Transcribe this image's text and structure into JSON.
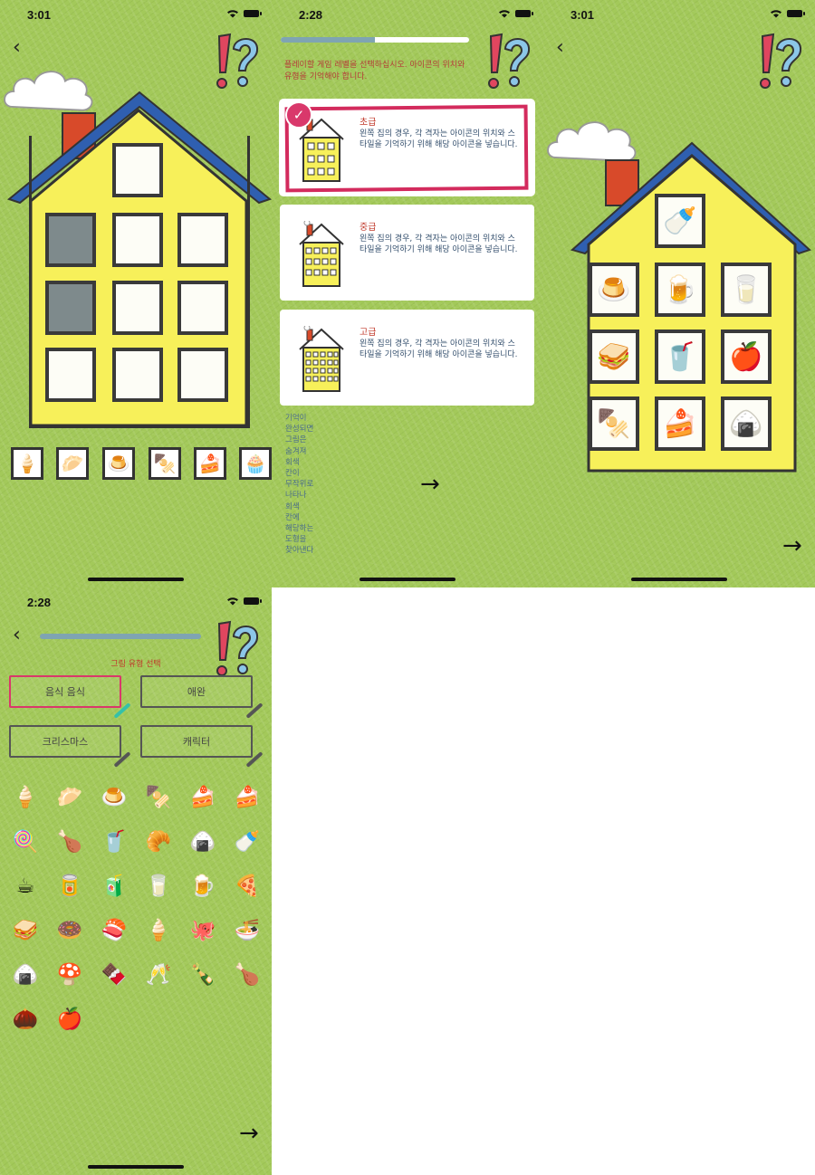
{
  "screens": {
    "s1": {
      "time": "3:01",
      "tray_items": [
        {
          "icon": "ice-cream-icon",
          "glyph": "🍦"
        },
        {
          "icon": "bun-icon",
          "glyph": "🥟"
        },
        {
          "icon": "pudding-icon",
          "glyph": "🍮"
        },
        {
          "icon": "skewer-icon",
          "glyph": "🍢"
        },
        {
          "icon": "cake-icon",
          "glyph": "🍰"
        },
        {
          "icon": "cake-slice-icon",
          "glyph": "🧁"
        }
      ]
    },
    "s2": {
      "time": "2:28",
      "progress": 0.5,
      "instruction": "플레이할 게임 레벨을 선택하십시오. 아이콘의 위치와 유형을 기억해야 합니다.",
      "levels": [
        {
          "title": "초급",
          "desc": "왼쪽 집의 경우, 각 격자는 아이콘의 위치와 스타일을 기억하기 위해 해당 아이콘을 넣습니다.",
          "selected": true
        },
        {
          "title": "중급",
          "desc": "왼쪽 집의 경우, 각 격자는 아이콘의 위치와 스타일을 기억하기 위해 해당 아이콘을 넣습니다.",
          "selected": false
        },
        {
          "title": "고급",
          "desc": "왼쪽 집의 경우, 각 격자는 아이콘의 위치와 스타일을 기억하기 위해 해당 아이콘을 넣습니다.",
          "selected": false
        }
      ],
      "vertical_text": [
        "기억이",
        "완성되면",
        "그림은",
        "숨겨져",
        "회색",
        "칸이",
        "무작위로",
        "나타나",
        "회색",
        "칸에",
        "해당하는",
        "도형을",
        "찾아낸다"
      ]
    },
    "s3": {
      "time": "3:01",
      "grid": [
        {
          "icon": "milk-bottle-icon",
          "glyph": "🍼"
        },
        {
          "icon": "pudding-icon",
          "glyph": "🍮"
        },
        {
          "icon": "beer-icon",
          "glyph": "🍺"
        },
        {
          "icon": "milk-carton-icon",
          "glyph": "🥛"
        },
        {
          "icon": "sandwich-icon",
          "glyph": "🥪"
        },
        {
          "icon": "iced-drink-icon",
          "glyph": "🥤"
        },
        {
          "icon": "apple-icon",
          "glyph": "🍎"
        },
        {
          "icon": "skewer-icon",
          "glyph": "🍢"
        },
        {
          "icon": "cake-icon",
          "glyph": "🍰"
        },
        {
          "icon": "rice-dumpling-icon",
          "glyph": "🍙"
        }
      ]
    },
    "s4": {
      "time": "2:28",
      "title": "그림 유형 선택",
      "categories": [
        "음식 음식",
        "애완",
        "크리스마스",
        "캐릭터"
      ],
      "foods": [
        {
          "icon": "ice-cream-cone-icon",
          "glyph": "🍦"
        },
        {
          "icon": "bun-icon",
          "glyph": "🥟"
        },
        {
          "icon": "pudding-icon",
          "glyph": "🍮"
        },
        {
          "icon": "skewer-icon",
          "glyph": "🍢"
        },
        {
          "icon": "cake-icon",
          "glyph": "🍰"
        },
        {
          "icon": "cake-slice-icon",
          "glyph": "🍰"
        },
        {
          "icon": "lollipop-icon",
          "glyph": "🍭"
        },
        {
          "icon": "drumstick-icon",
          "glyph": "🍗"
        },
        {
          "icon": "iced-drink-icon",
          "glyph": "🥤"
        },
        {
          "icon": "roll-cake-icon",
          "glyph": "🥐"
        },
        {
          "icon": "onigiri-icon",
          "glyph": "🍙"
        },
        {
          "icon": "milk-bottle-icon",
          "glyph": "🍼"
        },
        {
          "icon": "coffee-cup-icon",
          "glyph": "☕"
        },
        {
          "icon": "soda-can-icon",
          "glyph": "🥫"
        },
        {
          "icon": "juice-box-icon",
          "glyph": "🧃"
        },
        {
          "icon": "milk-carton-icon",
          "glyph": "🥛"
        },
        {
          "icon": "beer-icon",
          "glyph": "🍺"
        },
        {
          "icon": "pizza-icon",
          "glyph": "🍕"
        },
        {
          "icon": "sandwich-icon",
          "glyph": "🥪"
        },
        {
          "icon": "donut-icon",
          "glyph": "🍩"
        },
        {
          "icon": "sushi-icon",
          "glyph": "🍣"
        },
        {
          "icon": "soft-serve-icon",
          "glyph": "🍦"
        },
        {
          "icon": "octopus-icon",
          "glyph": "🐙"
        },
        {
          "icon": "noodle-bowl-icon",
          "glyph": "🍜"
        },
        {
          "icon": "rice-dumpling-icon",
          "glyph": "🍙"
        },
        {
          "icon": "mushroom-icon",
          "glyph": "🍄"
        },
        {
          "icon": "popsicle-icon",
          "glyph": "🍫"
        },
        {
          "icon": "wine-glasses-icon",
          "glyph": "🥂"
        },
        {
          "icon": "wine-bottle-icon",
          "glyph": "🍾"
        },
        {
          "icon": "roast-chicken-icon",
          "glyph": "🍗"
        },
        {
          "icon": "pinecone-icon",
          "glyph": "🌰"
        },
        {
          "icon": "apple-icon",
          "glyph": "🍎"
        }
      ]
    }
  },
  "colors": {
    "background": "#a3c95a",
    "house_wall": "#f7f05a",
    "roof": "#2f5fb0",
    "chimney": "#d84a2a",
    "accent": "#d32b5d"
  }
}
